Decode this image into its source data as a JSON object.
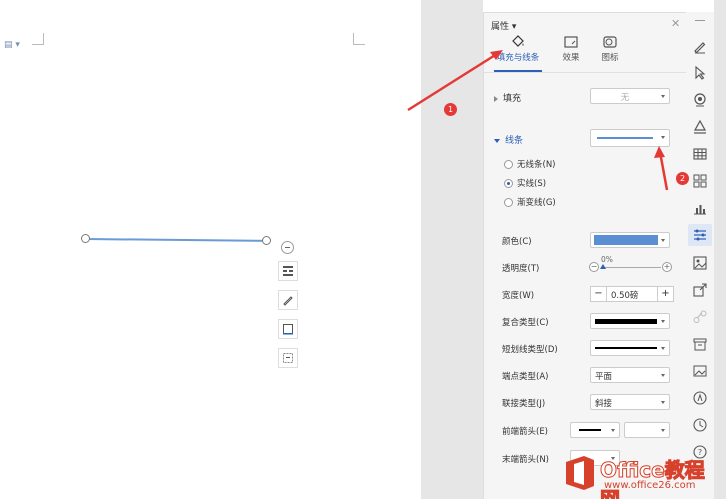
{
  "panel": {
    "title": "属性",
    "tabs": [
      {
        "label": "填充与线条",
        "icon": "paint-bucket-icon",
        "active": true
      },
      {
        "label": "效果",
        "icon": "effects-icon",
        "active": false
      },
      {
        "label": "图标",
        "icon": "shape-icon",
        "active": false
      }
    ],
    "fill": {
      "label": "填充",
      "value": "无"
    },
    "line": {
      "label": "线条",
      "options": {
        "none": "无线条(N)",
        "solid": "实线(S)",
        "gradient": "渐变线(G)"
      },
      "selected": "solid"
    },
    "props": {
      "color": {
        "label": "颜色(C)",
        "swatch": "#5b8fd4"
      },
      "transparency": {
        "label": "透明度(T)",
        "value": "0%"
      },
      "width": {
        "label": "宽度(W)",
        "value": "0.50磅",
        "minus": "−",
        "plus": "+"
      },
      "compound": {
        "label": "复合类型(C)"
      },
      "dash": {
        "label": "短划线类型(D)"
      },
      "cap": {
        "label": "端点类型(A)",
        "value": "平面"
      },
      "join": {
        "label": "联接类型(J)",
        "value": "斜接"
      },
      "start_arrow": {
        "label": "前端箭头(E)"
      },
      "end_arrow": {
        "label": "末端箭头(N)"
      }
    }
  },
  "annotations": {
    "badge1": "1",
    "badge2": "2",
    "color": "#e53935"
  },
  "watermark": {
    "text": "Office教程网",
    "url": "www.office26.com",
    "color": "#d7402a"
  },
  "toolbar": {
    "icons": [
      "pen-icon",
      "cursor-icon",
      "location-icon",
      "fill-icon",
      "table-icon",
      "grid-icon",
      "chart-icon",
      "settings-sliders-icon",
      "image-icon",
      "share-icon",
      "link-icon",
      "archive-icon",
      "picture-icon",
      "ai-icon",
      "history-icon",
      "help-icon"
    ]
  }
}
